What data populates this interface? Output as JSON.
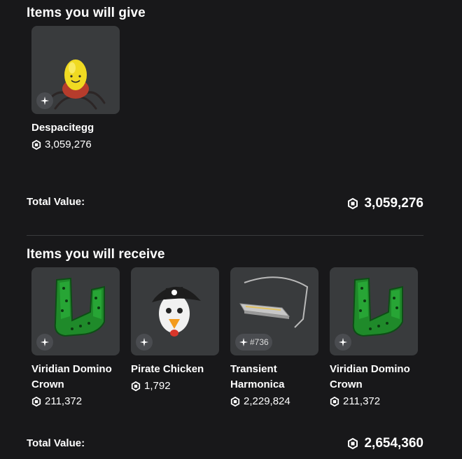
{
  "give": {
    "title": "Items you will give",
    "items": [
      {
        "name": "Despacitegg",
        "price": "3,059,276",
        "badge_icon": "limited-sparkle-icon",
        "serial": ""
      }
    ],
    "total_label": "Total Value:",
    "total_value": "3,059,276"
  },
  "receive": {
    "title": "Items you will receive",
    "items": [
      {
        "name": "Viridian Domino Crown",
        "price": "211,372",
        "badge_icon": "limited-sparkle-icon",
        "serial": ""
      },
      {
        "name": "Pirate Chicken",
        "price": "1,792",
        "badge_icon": "limited-sparkle-icon",
        "serial": ""
      },
      {
        "name": "Transient Harmonica",
        "price": "2,229,824",
        "badge_icon": "limited-sparkle-icon",
        "serial": "#736"
      },
      {
        "name": "Viridian Domino Crown",
        "price": "211,372",
        "badge_icon": "limited-sparkle-icon",
        "serial": ""
      }
    ],
    "total_label": "Total Value:",
    "total_value": "2,654,360"
  },
  "colors": {
    "background": "#18181a",
    "card": "#393b3d",
    "badge": "#4a4c50",
    "divider": "#393b3d"
  }
}
